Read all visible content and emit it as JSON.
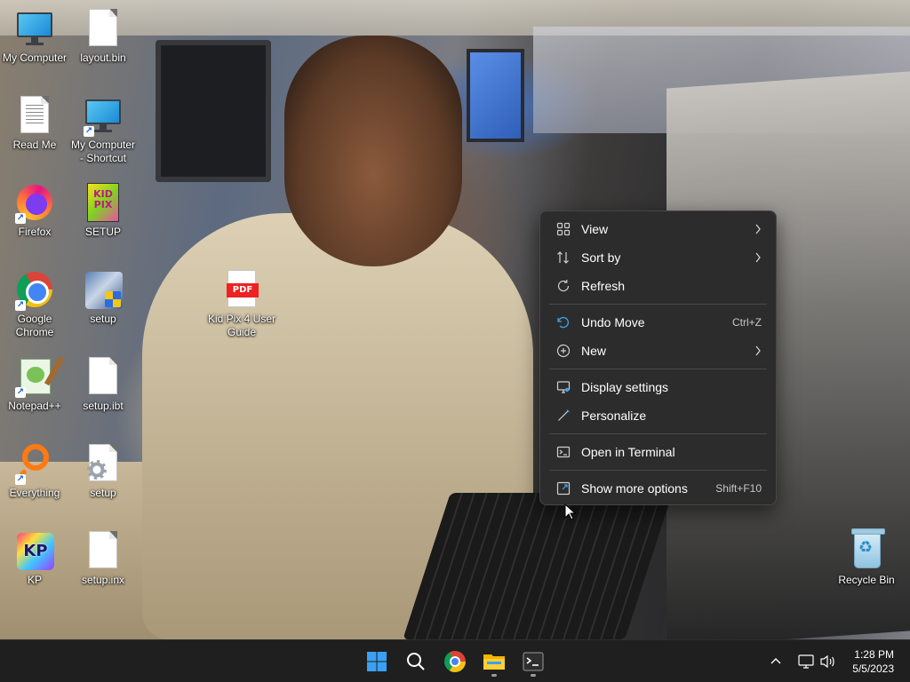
{
  "desktop": {
    "icons": [
      {
        "id": "my-computer",
        "label": "My Computer"
      },
      {
        "id": "layout-bin",
        "label": "layout.bin"
      },
      {
        "id": "read-me",
        "label": "Read Me"
      },
      {
        "id": "my-computer-shortcut",
        "label": "My Computer - Shortcut"
      },
      {
        "id": "firefox",
        "label": "Firefox"
      },
      {
        "id": "setup-kidpix",
        "label": "SETUP"
      },
      {
        "id": "google-chrome",
        "label": "Google Chrome"
      },
      {
        "id": "setup-exe",
        "label": "setup"
      },
      {
        "id": "kidpix-guide",
        "label": "Kid Pix 4 User Guide"
      },
      {
        "id": "notepadpp",
        "label": "Notepad++"
      },
      {
        "id": "setup-ibt",
        "label": "setup.ibt"
      },
      {
        "id": "everything",
        "label": "Everything"
      },
      {
        "id": "setup-gear",
        "label": "setup"
      },
      {
        "id": "kp",
        "label": "KP"
      },
      {
        "id": "setup-inx",
        "label": "setup.inx"
      },
      {
        "id": "recycle-bin",
        "label": "Recycle Bin"
      }
    ],
    "kidpix_icon_text": "KID PIX",
    "pdf_icon_text": "PDF",
    "kp_icon_text": "KP"
  },
  "context_menu": {
    "items": [
      {
        "label": "View",
        "icon": "grid-icon",
        "submenu": true
      },
      {
        "label": "Sort by",
        "icon": "sort-icon",
        "submenu": true
      },
      {
        "label": "Refresh",
        "icon": "refresh-icon"
      },
      {
        "label": "Undo Move",
        "icon": "undo-icon",
        "shortcut": "Ctrl+Z"
      },
      {
        "label": "New",
        "icon": "new-icon",
        "submenu": true
      },
      {
        "label": "Display settings",
        "icon": "display-icon"
      },
      {
        "label": "Personalize",
        "icon": "brush-icon"
      },
      {
        "label": "Open in Terminal",
        "icon": "terminal-icon"
      },
      {
        "label": "Show more options",
        "icon": "more-options-icon",
        "shortcut": "Shift+F10"
      }
    ]
  },
  "taskbar": {
    "apps": [
      "start-icon",
      "search-icon",
      "chrome-icon",
      "file-explorer-icon",
      "terminal-icon"
    ],
    "tray_icons": [
      "chevron-up-icon",
      "network-icon",
      "volume-icon"
    ],
    "time": "1:28 PM",
    "date": "5/5/2023"
  },
  "colors": {
    "menu_bg": "#2c2c2c",
    "taskbar_bg": "#1f1f1f",
    "accent_blue": "#3aa0f3"
  }
}
